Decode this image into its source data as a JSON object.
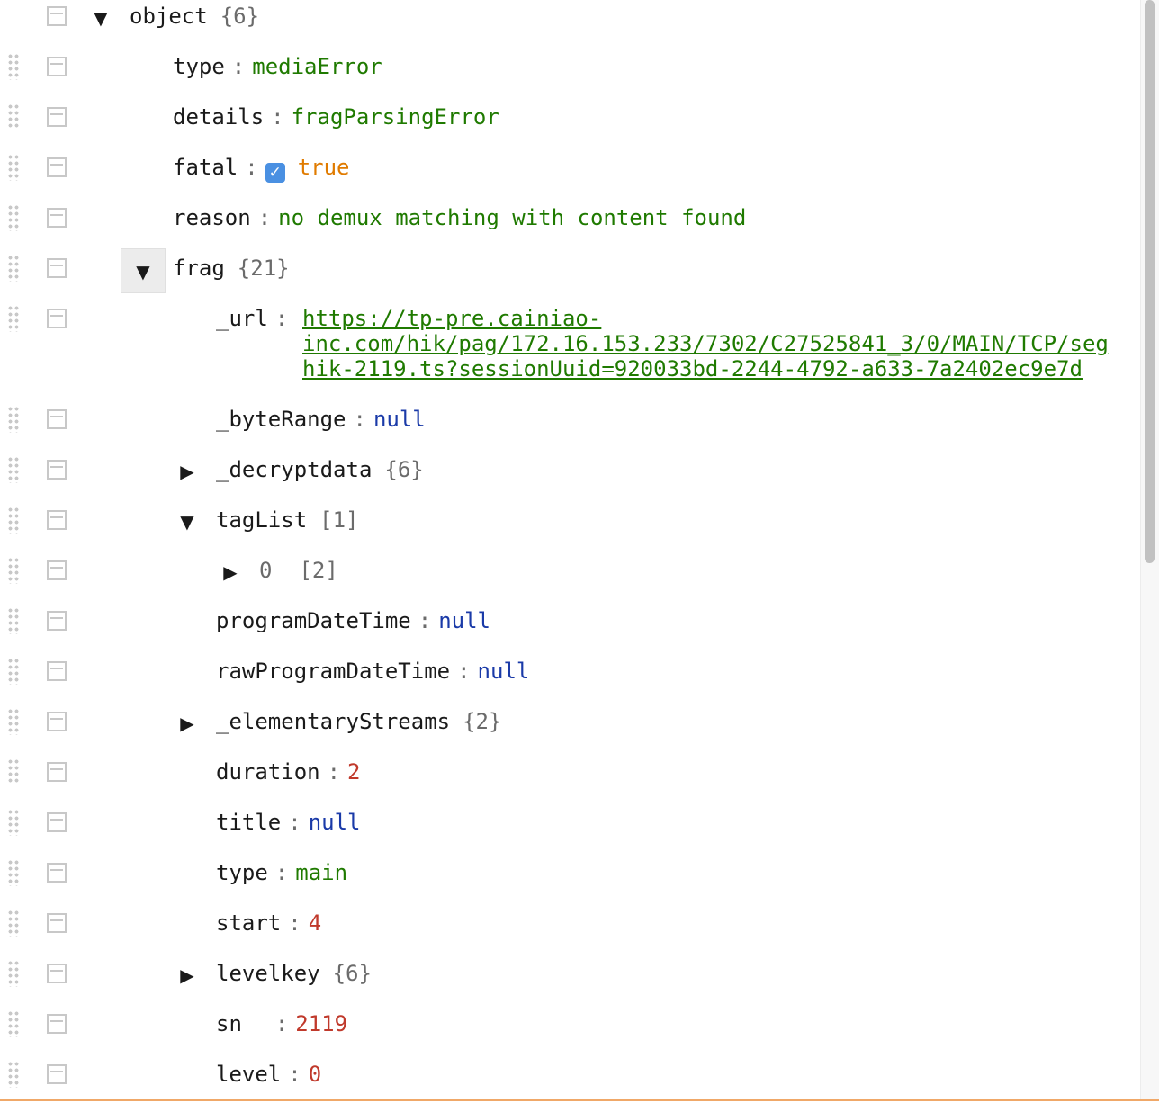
{
  "rows": [
    {
      "depth": 0,
      "kind": "object",
      "expanded": true,
      "key": "object",
      "count": "{6}",
      "top_row": true
    },
    {
      "depth": 1,
      "kind": "string",
      "key": "type",
      "value": "mediaError"
    },
    {
      "depth": 1,
      "kind": "string",
      "key": "details",
      "value": "fragParsingError"
    },
    {
      "depth": 1,
      "kind": "boolean",
      "key": "fatal",
      "value": "true",
      "checked": true
    },
    {
      "depth": 1,
      "kind": "string",
      "key": "reason",
      "value": "no demux matching with content found"
    },
    {
      "depth": 1,
      "kind": "object",
      "expanded": true,
      "boxed": true,
      "key": "frag",
      "count": "{21}"
    },
    {
      "depth": 2,
      "kind": "url",
      "key": "_url",
      "value_lines": [
        "https://tp-pre.cainiao-",
        "inc.com/hik/pag/172.16.153.233/7302/C27525841_3/0/MAIN/TCP/seg",
        "hik-2119.ts?sessionUuid=920033bd-2244-4792-a633-7a2402ec9e7d"
      ]
    },
    {
      "depth": 2,
      "kind": "null",
      "key": "_byteRange",
      "value": "null"
    },
    {
      "depth": 2,
      "kind": "object",
      "expanded": false,
      "key": "_decryptdata",
      "count": "{6}"
    },
    {
      "depth": 2,
      "kind": "array",
      "expanded": true,
      "key": "tagList",
      "count": "[1]"
    },
    {
      "depth": 3,
      "kind": "array",
      "expanded": false,
      "key": "0",
      "count": "[2]",
      "index": true
    },
    {
      "depth": 2,
      "kind": "null",
      "key": "programDateTime",
      "value": "null"
    },
    {
      "depth": 2,
      "kind": "null",
      "key": "rawProgramDateTime",
      "value": "null"
    },
    {
      "depth": 2,
      "kind": "object",
      "expanded": false,
      "key": "_elementaryStreams",
      "count": "{2}"
    },
    {
      "depth": 2,
      "kind": "number",
      "key": "duration",
      "value": "2"
    },
    {
      "depth": 2,
      "kind": "null",
      "key": "title",
      "value": "null"
    },
    {
      "depth": 2,
      "kind": "string",
      "key": "type",
      "value": "main"
    },
    {
      "depth": 2,
      "kind": "number",
      "key": "start",
      "value": "4"
    },
    {
      "depth": 2,
      "kind": "object",
      "expanded": false,
      "key": "levelkey",
      "count": "{6}"
    },
    {
      "depth": 2,
      "kind": "number",
      "key": "sn",
      "value": "2119",
      "key_pad": "  "
    },
    {
      "depth": 2,
      "kind": "number",
      "key": "level",
      "value": "0"
    }
  ],
  "symbols": {
    "separator": ":",
    "expanded_arrow": "▼",
    "collapsed_arrow": "▶",
    "check_mark": "✓"
  },
  "colors": {
    "string": "#1f7a00",
    "null": "#1a3aa8",
    "number": "#c0392b",
    "boolean": "#e07b00",
    "muted": "#6b6b6b",
    "accent": "#4a90e2"
  }
}
